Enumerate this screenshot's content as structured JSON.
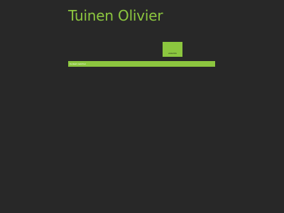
{
  "header": {
    "title": "Tuinen Olivier"
  },
  "badge": {
    "label": "www.link"
  },
  "nav": {
    "link_label": "Contact meld het"
  },
  "colors": {
    "background": "#282828",
    "accent": "#8cc63f"
  }
}
